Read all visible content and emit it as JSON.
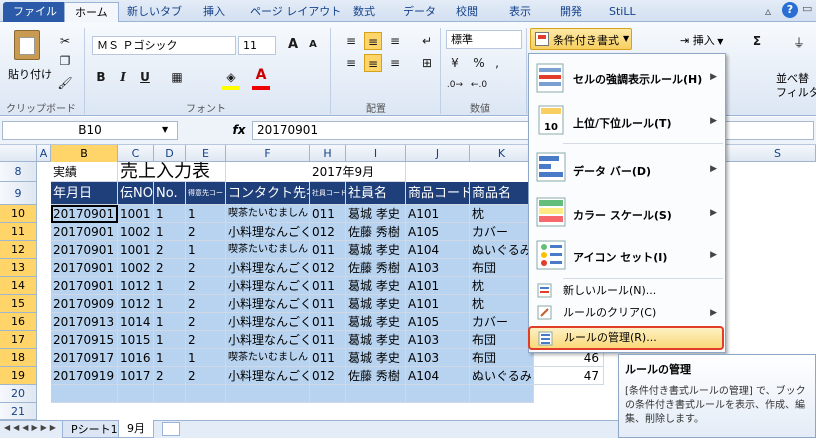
{
  "tabs": [
    "ファイル",
    "ホーム",
    "新しいタブ",
    "挿入",
    "ページ レイアウト",
    "数式",
    "データ",
    "校閲",
    "表示",
    "開発",
    "StiLL"
  ],
  "ribbon": {
    "clipboard": {
      "paste": "貼り付け",
      "label": "クリップボード"
    },
    "font": {
      "name": "ＭＳ Ｐゴシック",
      "size": "11",
      "bold": "B",
      "italic": "I",
      "underline": "U",
      "label": "フォント",
      "grow": "A",
      "shrink": "A"
    },
    "alignment": {
      "label": "配置"
    },
    "number": {
      "format": "標準",
      "percent": "%",
      "comma": ",",
      "label": "数値"
    },
    "cf_button": "条件付き書式",
    "insert": "挿入",
    "sort": "並べ替",
    "filter": "フィルタ-"
  },
  "formula_bar": {
    "name_box": "B10",
    "fx": "fx",
    "value": "20170901"
  },
  "columns": [
    "A",
    "B",
    "C",
    "D",
    "E",
    "F",
    "H",
    "I",
    "J",
    "K",
    "S"
  ],
  "rows": [
    "8",
    "9",
    "10",
    "11",
    "12",
    "13",
    "14",
    "15",
    "16",
    "17",
    "18",
    "19",
    "20",
    "21"
  ],
  "row8": {
    "jisseki": "実績",
    "title": "売上入力表",
    "period": "2017年9月"
  },
  "headers": {
    "date": "年月日",
    "code": "伝NO",
    "no": "No.",
    "scode": "得意先コード",
    "contact": "コンタクト先名",
    "emp_code": "社員コード",
    "emp": "社員名",
    "prod_code": "商品コード",
    "prod": "商品名"
  },
  "data_rows": [
    {
      "date": "20170901",
      "code": "1001",
      "no": "1",
      "scode": "1",
      "contact": "喫茶たいむましん",
      "ec": "011",
      "emp": "葛城 孝史",
      "pc": "A101",
      "prod": "枕"
    },
    {
      "date": "20170901",
      "code": "1002",
      "no": "1",
      "scode": "2",
      "contact": "小料理なんごく",
      "ec": "012",
      "emp": "佐藤 秀樹",
      "pc": "A105",
      "prod": "カバー"
    },
    {
      "date": "20170901",
      "code": "1001",
      "no": "2",
      "scode": "1",
      "contact": "喫茶たいむましん",
      "ec": "011",
      "emp": "葛城 孝史",
      "pc": "A104",
      "prod": "ぬいぐるみ"
    },
    {
      "date": "20170901",
      "code": "1002",
      "no": "2",
      "scode": "2",
      "contact": "小料理なんごく",
      "ec": "012",
      "emp": "佐藤 秀樹",
      "pc": "A103",
      "prod": "布団"
    },
    {
      "date": "20170901",
      "code": "1012",
      "no": "1",
      "scode": "2",
      "contact": "小料理なんごく",
      "ec": "011",
      "emp": "葛城 孝史",
      "pc": "A101",
      "prod": "枕"
    },
    {
      "date": "20170909",
      "code": "1012",
      "no": "1",
      "scode": "2",
      "contact": "小料理なんごく",
      "ec": "011",
      "emp": "葛城 孝史",
      "pc": "A101",
      "prod": "枕"
    },
    {
      "date": "20170913",
      "code": "1014",
      "no": "1",
      "scode": "2",
      "contact": "小料理なんごく",
      "ec": "011",
      "emp": "葛城 孝史",
      "pc": "A105",
      "prod": "カバー"
    },
    {
      "date": "20170915",
      "code": "1015",
      "no": "1",
      "scode": "2",
      "contact": "小料理なんごく",
      "ec": "011",
      "emp": "葛城 孝史",
      "pc": "A103",
      "prod": "布団"
    },
    {
      "date": "20170917",
      "code": "1016",
      "no": "1",
      "scode": "1",
      "contact": "喫茶たいむましん",
      "ec": "011",
      "emp": "葛城 孝史",
      "pc": "A103",
      "prod": "布団",
      "extra": "46"
    },
    {
      "date": "20170919",
      "code": "1017",
      "no": "2",
      "scode": "2",
      "contact": "小料理なんごく",
      "ec": "012",
      "emp": "佐藤 秀樹",
      "pc": "A104",
      "prod": "ぬいぐるみ",
      "extra": "47"
    }
  ],
  "cf_menu": {
    "items": [
      {
        "label": "セルの強調表示ルール(H)"
      },
      {
        "label": "上位/下位ルール(T)"
      },
      {
        "label": "データ バー(D)"
      },
      {
        "label": "カラー スケール(S)"
      },
      {
        "label": "アイコン セット(I)"
      }
    ],
    "small": [
      "新しいルール(N)...",
      "ルールのクリア(C)",
      "ルールの管理(R)..."
    ]
  },
  "tooltip": {
    "title": "ルールの管理",
    "body": "[条件付き書式ルールの管理] で、ブックの条件付き書式ルールを表示、作成、編集、削除します。"
  },
  "sheets": [
    "Pシート1",
    "9月"
  ],
  "colors": {
    "header_bg": "#1f3f7a",
    "row_bg": "#b8d3f0",
    "selected_row": "#ffd56a",
    "highlight": "#e23c2a"
  }
}
